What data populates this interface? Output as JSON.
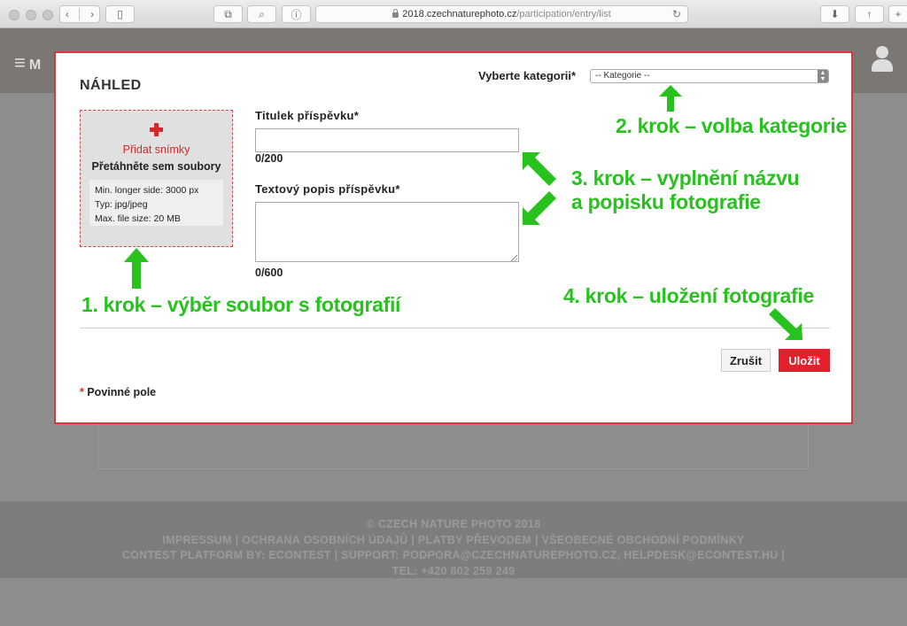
{
  "browser": {
    "url_host": "2018.czechnaturephoto.cz",
    "url_path": "/participation/entry/list"
  },
  "page": {
    "menu_label": "M",
    "footer_lines": [
      "© CZECH NATURE PHOTO 2018",
      "IMPRESSUM | OCHRANA OSOBNÍCH ÚDAJŮ | PLATBY PŘEVODEM | VŠEOBECNÉ OBCHODNÍ PODMÍNKY",
      "CONTEST PLATFORM BY: ECONTEST | SUPPORT: PODPORA@CZECHNATUREPHOTO.CZ, HELPDESK@ECONTEST.HU |",
      "TEL: +420 602 259 249"
    ]
  },
  "modal": {
    "title": "NÁHLED",
    "category_label": "Vyberte kategorii*",
    "category_value": "-- Kategorie --",
    "upload": {
      "add_label": "Přidat snímky",
      "drag_label": "Přetáhněte sem soubory",
      "specs": [
        "Min. longer side:  3000 px",
        "Typ:  jpg/jpeg",
        "Max. file size:  20 MB"
      ]
    },
    "title_field_label": "Titulek příspěvku*",
    "title_value": "",
    "title_counter": "0/200",
    "desc_field_label": "Textový popis příspěvku*",
    "desc_value": "",
    "desc_counter": "0/600",
    "cancel_label": "Zrušit",
    "save_label": "Uložit",
    "required_star": "*",
    "required_note": " Povinné pole"
  },
  "annotations": {
    "step1": "1. krok – výběr soubor s fotografií",
    "step2": "2. krok – volba kategorie",
    "step3_line1": "3. krok – vyplnění názvu",
    "step3_line2": "a popisku fotografie",
    "step4": "4. krok – uložení fotografie",
    "color": "#27c21e"
  },
  "colors": {
    "accent_red": "#e3202b",
    "modal_border": "#d83a3a"
  }
}
